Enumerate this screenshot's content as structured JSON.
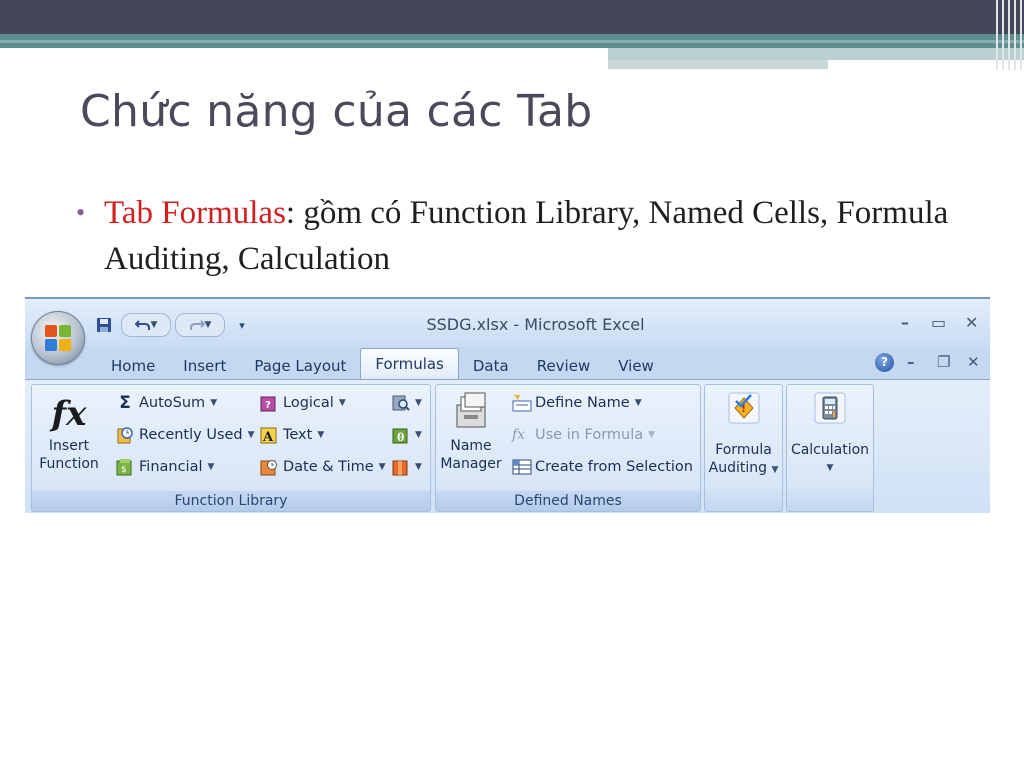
{
  "slide": {
    "title": "Chức năng của các Tab",
    "bullet_highlight": "Tab Formulas",
    "bullet_rest": ": gồm có Function Library, Named Cells, Formula Auditing, Calculation"
  },
  "excel": {
    "window_title": "SSDG.xlsx - Microsoft Excel",
    "window_controls": {
      "minimize": "–",
      "restore": "▭",
      "close": "✕"
    },
    "doc_controls": {
      "minimize": "–",
      "restore": "❐",
      "close": "✕"
    },
    "help": "?",
    "tabs": [
      "Home",
      "Insert",
      "Page Layout",
      "Formulas",
      "Data",
      "Review",
      "View"
    ],
    "active_tab": "Formulas",
    "groups": {
      "function_library": {
        "label": "Function Library",
        "insert_function": [
          "Insert",
          "Function"
        ],
        "fx_glyph": "fx",
        "autosum": "AutoSum",
        "recently_used": "Recently Used",
        "financial": "Financial",
        "logical": "Logical",
        "text": "Text",
        "date_time": "Date & Time",
        "sigma": "Σ"
      },
      "defined_names": {
        "label": "Defined Names",
        "name_manager": [
          "Name",
          "Manager"
        ],
        "define_name": "Define Name",
        "use_in_formula": "Use in Formula",
        "create_from_selection": "Create from Selection"
      },
      "formula_auditing": {
        "label": [
          "Formula",
          "Auditing"
        ]
      },
      "calculation": {
        "label": "Calculation"
      }
    },
    "colors": {
      "accent": "#1e3963",
      "highlight_red": "#d11f1f"
    }
  }
}
